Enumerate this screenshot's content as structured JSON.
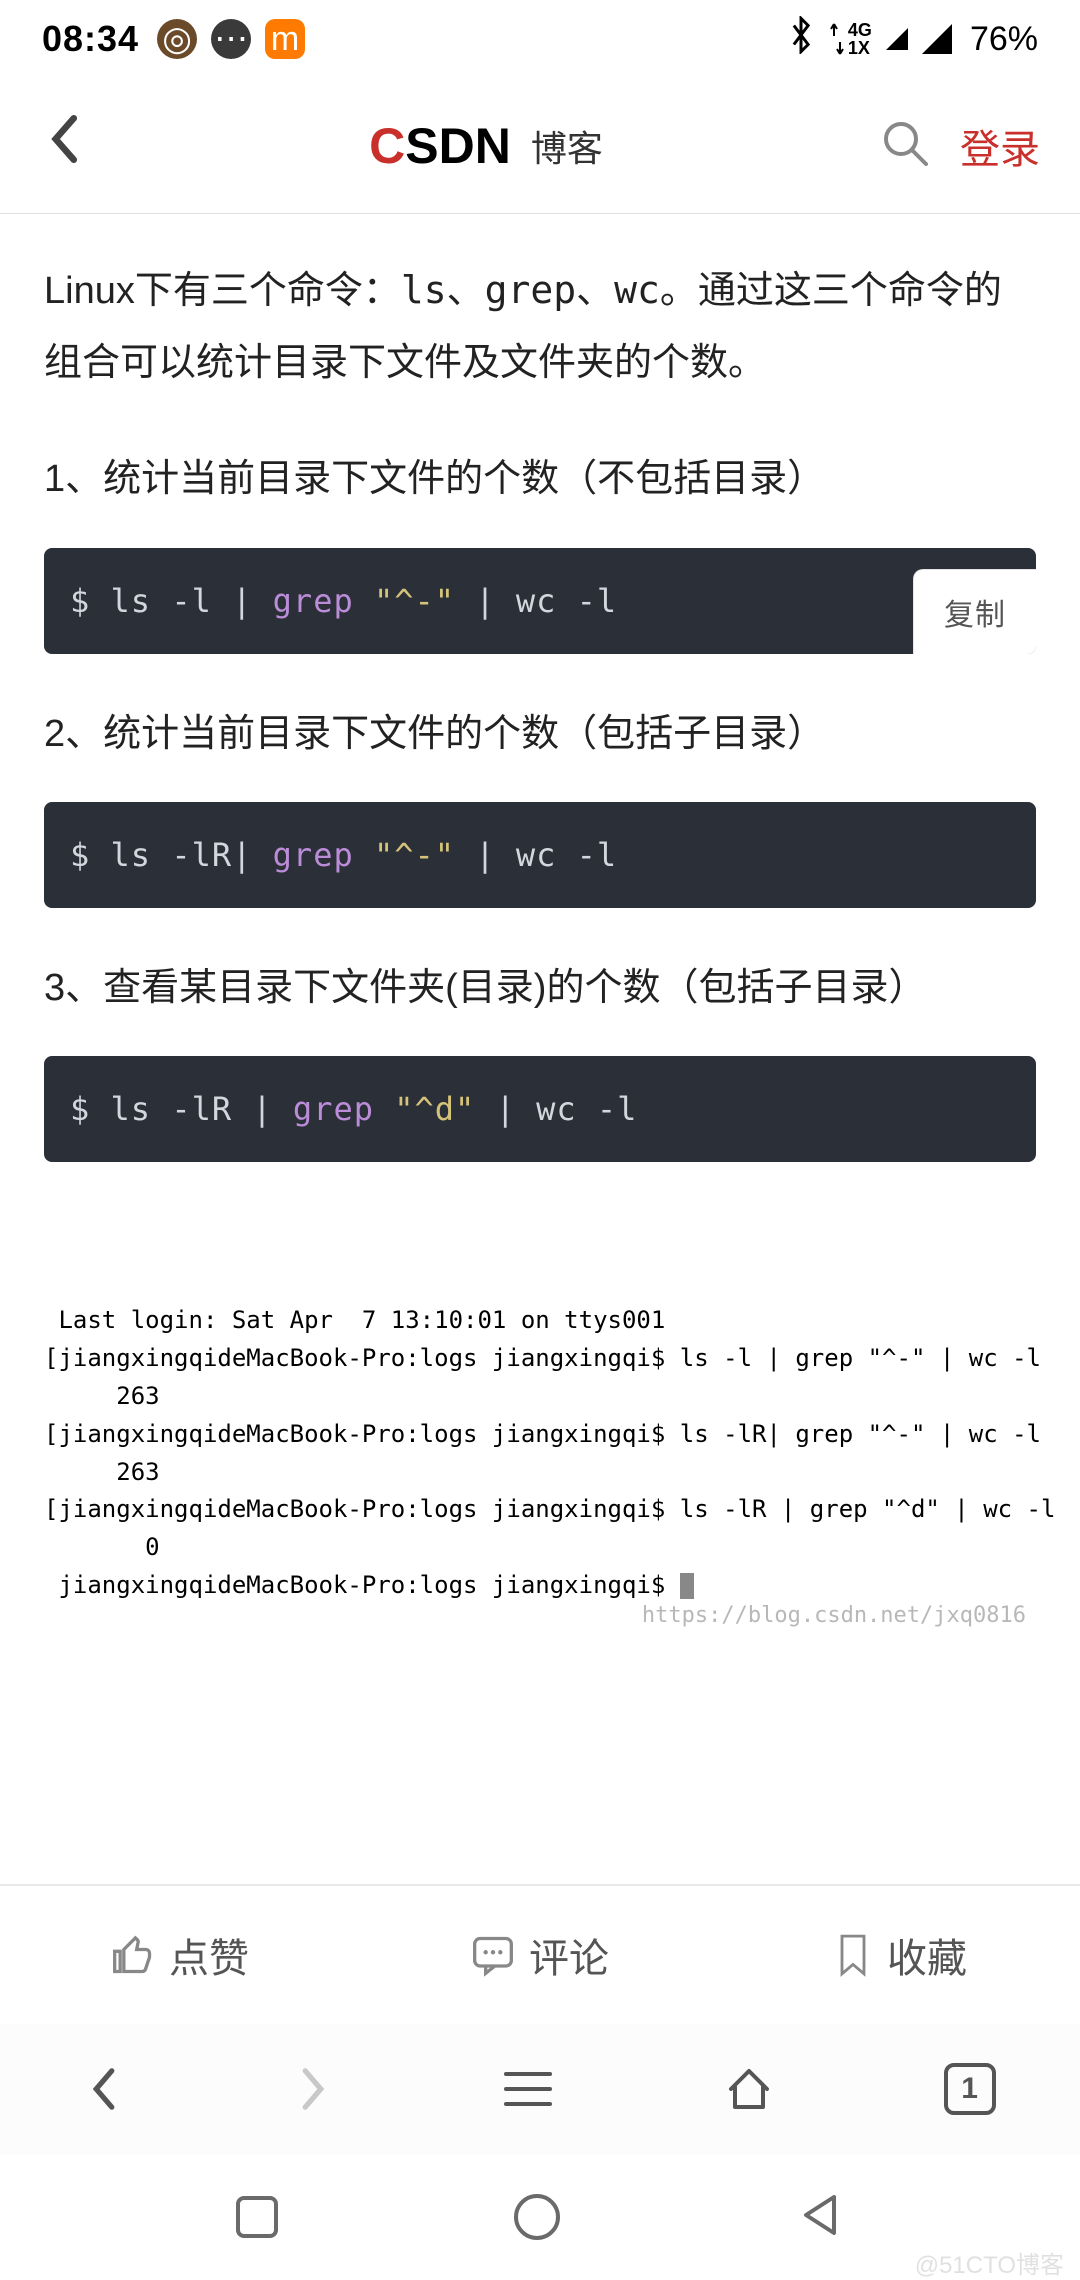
{
  "status": {
    "time": "08:34",
    "bluetooth": "bluetooth",
    "net_top": "4G",
    "net_bottom": "1X",
    "battery": "76%"
  },
  "header": {
    "logo_main": "CSDN",
    "logo_sub": "博客",
    "login": "登录"
  },
  "article": {
    "intro_pre": "Linux下有三个命令：",
    "intro_cmds": "ls、grep、wc",
    "intro_post": "。通过这三个命令的组合可以统计目录下文件及文件夹的个数。",
    "sections": [
      {
        "title": "1、统计当前目录下文件的个数（不包括目录）",
        "code_prefix": "$ ls -l | ",
        "code_grep": "grep",
        "code_str": " \"^-\"",
        "code_suffix": " | wc -l",
        "copy": "复制"
      },
      {
        "title": "2、统计当前目录下文件的个数（包括子目录）",
        "code_prefix": "$ ls -lR| ",
        "code_grep": "grep",
        "code_str": " \"^-\"",
        "code_suffix": " | wc -l"
      },
      {
        "title": "3、查看某目录下文件夹(目录)的个数（包括子目录）",
        "code_prefix": "$ ls -lR | ",
        "code_grep": "grep",
        "code_str": " \"^d\"",
        "code_suffix": " | wc -l"
      }
    ]
  },
  "terminal": {
    "line1": " Last login: Sat Apr  7 13:10:01 on ttys001",
    "line2": "[jiangxingqideMacBook-Pro:logs jiangxingqi$ ls -l | grep \"^-\" | wc -l",
    "line3": "     263",
    "line4": "[jiangxingqideMacBook-Pro:logs jiangxingqi$ ls -lR| grep \"^-\" | wc -l",
    "line5": "     263",
    "line6": "[jiangxingqideMacBook-Pro:logs jiangxingqi$ ls -lR | grep \"^d\" | wc -l",
    "line7": "       0",
    "line8": " jiangxingqideMacBook-Pro:logs jiangxingqi$ ",
    "watermark_url": "https://blog.csdn.net/jxq0816"
  },
  "actions": {
    "like": "点赞",
    "comment": "评论",
    "favorite": "收藏"
  },
  "browser": {
    "tab_count": "1"
  },
  "footer_watermark": "@51CTO博客"
}
